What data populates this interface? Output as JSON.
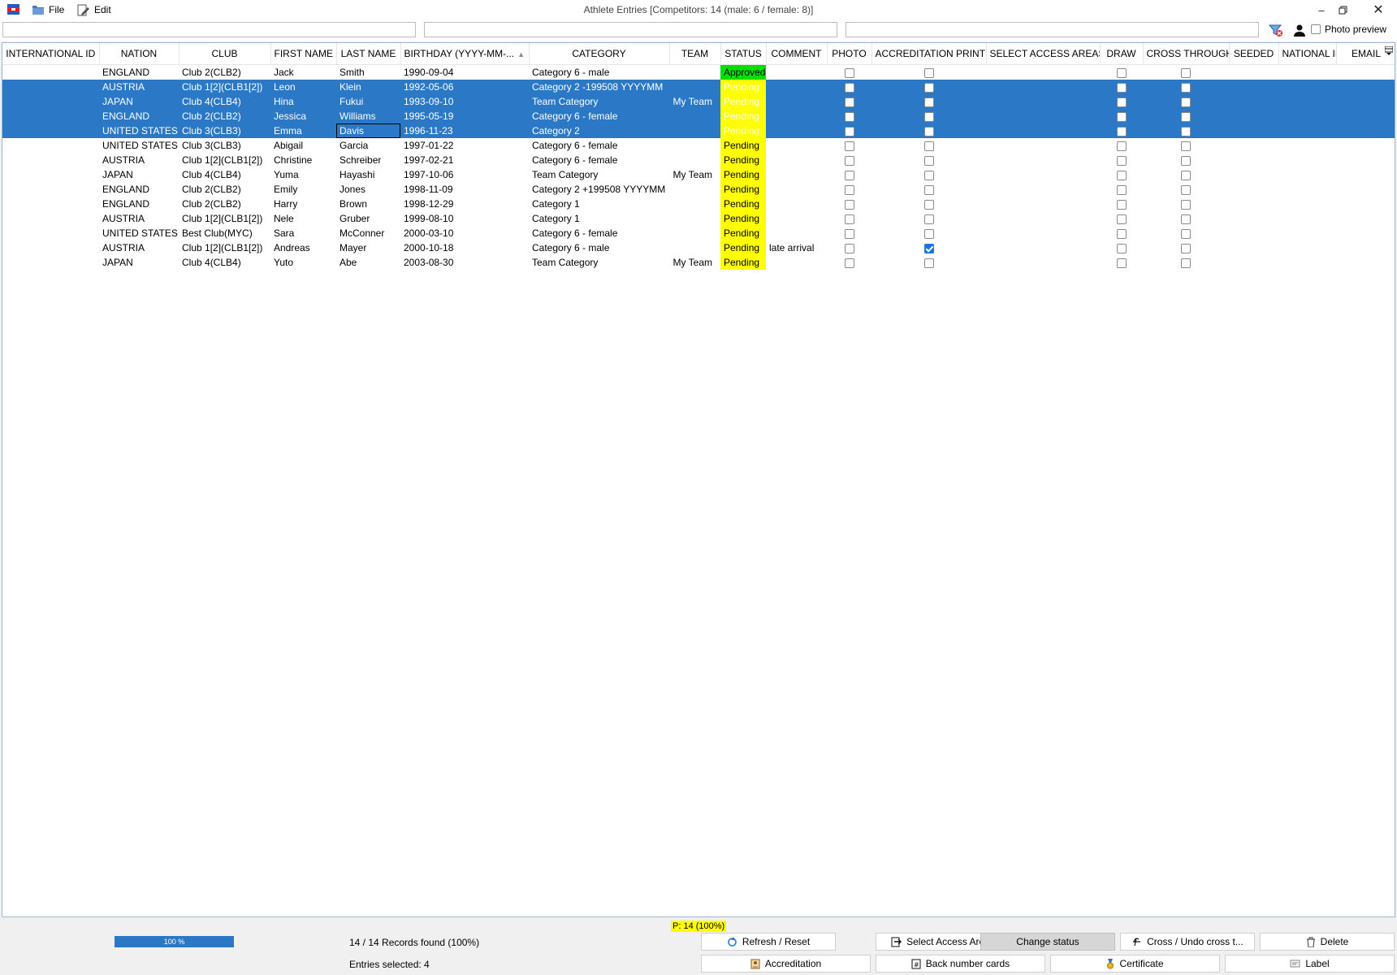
{
  "window": {
    "title": "Athlete Entries [Competitors: 14 (male: 6 / female: 8)]",
    "menu": {
      "file": "File",
      "edit": "Edit"
    }
  },
  "filters": {
    "photo_preview_label": "Photo preview",
    "photo_preview_checked": false
  },
  "columns": [
    "INTERNATIONAL ID",
    "NATION",
    "CLUB",
    "FIRST NAME",
    "LAST NAME",
    "BIRTHDAY (YYYY-MM-...",
    "CATEGORY",
    "TEAM",
    "STATUS",
    "COMMENT",
    "PHOTO",
    "ACCREDITATION PRINT",
    "SELECT ACCESS AREAS",
    "DRAW",
    "CROSS THROUGH",
    "SEEDED",
    "NATIONAL ID",
    "EMAIL"
  ],
  "sort_column": "BIRTHDAY (YYYY-MM-...",
  "rows": [
    {
      "international_id": "",
      "nation": "ENGLAND",
      "club": "Club 2(CLB2)",
      "first": "Jack",
      "last": "Smith",
      "birthday": "1990-09-04",
      "category": "Category 6 - male",
      "team": "",
      "status": "Approved",
      "comment": "",
      "photo": false,
      "accreditation": false,
      "draw": false,
      "cross": false,
      "selected": false
    },
    {
      "international_id": "",
      "nation": "AUSTRIA",
      "club": "Club 1[2](CLB1[2])",
      "first": "Leon",
      "last": "Klein",
      "birthday": "1992-05-06",
      "category": "Category 2 -199508 YYYYMM",
      "team": "",
      "status": "Pending",
      "comment": "",
      "photo": false,
      "accreditation": false,
      "draw": false,
      "cross": false,
      "selected": true
    },
    {
      "international_id": "",
      "nation": "JAPAN",
      "club": "Club 4(CLB4)",
      "first": "Hina",
      "last": "Fukui",
      "birthday": "1993-09-10",
      "category": "Team Category",
      "team": "My Team",
      "status": "Pending",
      "comment": "",
      "photo": false,
      "accreditation": false,
      "draw": false,
      "cross": false,
      "selected": true
    },
    {
      "international_id": "",
      "nation": "ENGLAND",
      "club": "Club 2(CLB2)",
      "first": "Jessica",
      "last": "Williams",
      "birthday": "1995-05-19",
      "category": "Category 6 - female",
      "team": "",
      "status": "Pending",
      "comment": "",
      "photo": false,
      "accreditation": false,
      "draw": false,
      "cross": false,
      "selected": true
    },
    {
      "international_id": "",
      "nation": "UNITED STATES",
      "club": "Club 3(CLB3)",
      "first": "Emma",
      "last": "Davis",
      "birthday": "1996-11-23",
      "category": "Category 2",
      "team": "",
      "status": "Pending",
      "comment": "",
      "photo": false,
      "accreditation": false,
      "draw": false,
      "cross": false,
      "selected": true,
      "focus": "last"
    },
    {
      "international_id": "",
      "nation": "UNITED STATES",
      "club": "Club 3(CLB3)",
      "first": "Abigail",
      "last": "Garcia",
      "birthday": "1997-01-22",
      "category": "Category 6 - female",
      "team": "",
      "status": "Pending",
      "comment": "",
      "photo": false,
      "accreditation": false,
      "draw": false,
      "cross": false,
      "selected": false
    },
    {
      "international_id": "",
      "nation": "AUSTRIA",
      "club": "Club 1[2](CLB1[2])",
      "first": "Christine",
      "last": "Schreiber",
      "birthday": "1997-02-21",
      "category": "Category 6 - female",
      "team": "",
      "status": "Pending",
      "comment": "",
      "photo": false,
      "accreditation": false,
      "draw": false,
      "cross": false,
      "selected": false
    },
    {
      "international_id": "",
      "nation": "JAPAN",
      "club": "Club 4(CLB4)",
      "first": "Yuma",
      "last": "Hayashi",
      "birthday": "1997-10-06",
      "category": "Team Category",
      "team": "My Team",
      "status": "Pending",
      "comment": "",
      "photo": false,
      "accreditation": false,
      "draw": false,
      "cross": false,
      "selected": false
    },
    {
      "international_id": "",
      "nation": "ENGLAND",
      "club": "Club 2(CLB2)",
      "first": "Emily",
      "last": "Jones",
      "birthday": "1998-11-09",
      "category": "Category 2 +199508 YYYYMM",
      "team": "",
      "status": "Pending",
      "comment": "",
      "photo": false,
      "accreditation": false,
      "draw": false,
      "cross": false,
      "selected": false
    },
    {
      "international_id": "",
      "nation": "ENGLAND",
      "club": "Club 2(CLB2)",
      "first": "Harry",
      "last": "Brown",
      "birthday": "1998-12-29",
      "category": "Category 1",
      "team": "",
      "status": "Pending",
      "comment": "",
      "photo": false,
      "accreditation": false,
      "draw": false,
      "cross": false,
      "selected": false
    },
    {
      "international_id": "",
      "nation": "AUSTRIA",
      "club": "Club 1[2](CLB1[2])",
      "first": "Nele",
      "last": "Gruber",
      "birthday": "1999-08-10",
      "category": "Category 1",
      "team": "",
      "status": "Pending",
      "comment": "",
      "photo": false,
      "accreditation": false,
      "draw": false,
      "cross": false,
      "selected": false
    },
    {
      "international_id": "",
      "nation": "UNITED STATES",
      "club": "Best Club(MYC)",
      "first": "Sara",
      "last": "McConner",
      "birthday": "2000-03-10",
      "category": "Category 6 - female",
      "team": "",
      "status": "Pending",
      "comment": "",
      "photo": false,
      "accreditation": false,
      "draw": false,
      "cross": false,
      "selected": false
    },
    {
      "international_id": "",
      "nation": "AUSTRIA",
      "club": "Club 1[2](CLB1[2])",
      "first": "Andreas",
      "last": "Mayer",
      "birthday": "2000-10-18",
      "category": "Category 6 - male",
      "team": "",
      "status": "Pending",
      "comment": "late arrival",
      "photo": false,
      "accreditation": true,
      "draw": false,
      "cross": false,
      "selected": false
    },
    {
      "international_id": "",
      "nation": "JAPAN",
      "club": "Club 4(CLB4)",
      "first": "Yuto",
      "last": "Abe",
      "birthday": "2003-08-30",
      "category": "Team Category",
      "team": "My Team",
      "status": "Pending",
      "comment": "",
      "photo": false,
      "accreditation": false,
      "draw": false,
      "cross": false,
      "selected": false
    }
  ],
  "status_colors": {
    "Approved": "#00e000",
    "Pending": "#ffff00",
    "selection": "#2b79c6"
  },
  "footer": {
    "pending_badge": "P: 14 (100%)",
    "progress_label": "100 %",
    "progress_fraction": 1.0,
    "records_found": "14 / 14 Records found (100%)",
    "entries_selected": "Entries selected: 4",
    "buttons": {
      "refresh": "Refresh / Reset",
      "select_access": "Select Access Areas",
      "change_status": "Change status",
      "cross": "Cross / Undo cross t...",
      "delete": "Delete",
      "accreditation": "Accreditation",
      "back_number": "Back number cards",
      "certificate": "Certificate",
      "label": "Label"
    }
  }
}
